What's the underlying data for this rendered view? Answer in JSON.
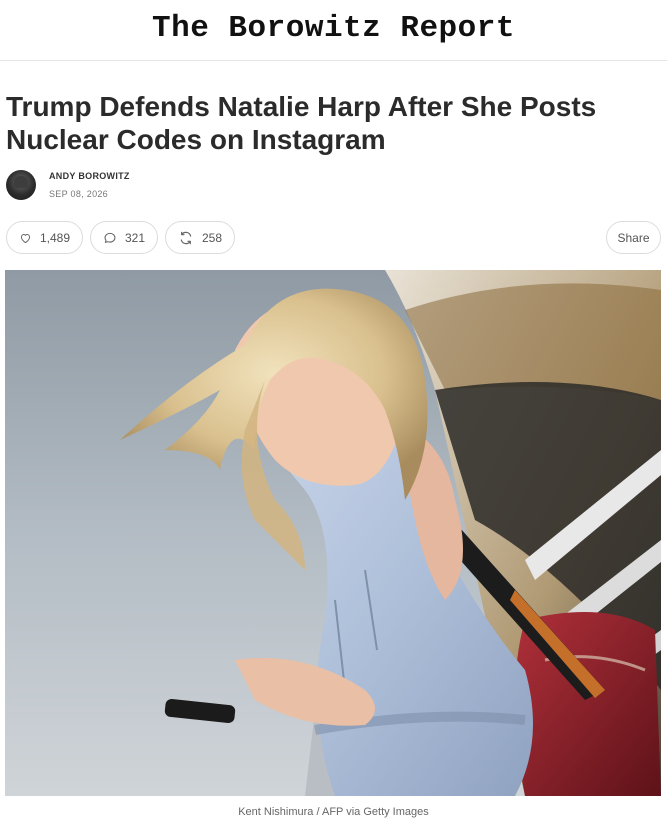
{
  "masthead": {
    "title": "The Borowitz Report"
  },
  "article": {
    "headline": "Trump Defends Natalie Harp After She Posts Nuclear Codes on Instagram",
    "author": "ANDY BOROWITZ",
    "date": "SEP 08, 2026"
  },
  "actions": {
    "likes": "1,489",
    "comments": "321",
    "restacks": "258",
    "share_label": "Share"
  },
  "hero": {
    "caption": "Kent Nishimura / AFP via Getty Images"
  },
  "icons": {
    "like": "heart-icon",
    "comment": "comment-bubble-icon",
    "restack": "restack-arrows-icon"
  }
}
